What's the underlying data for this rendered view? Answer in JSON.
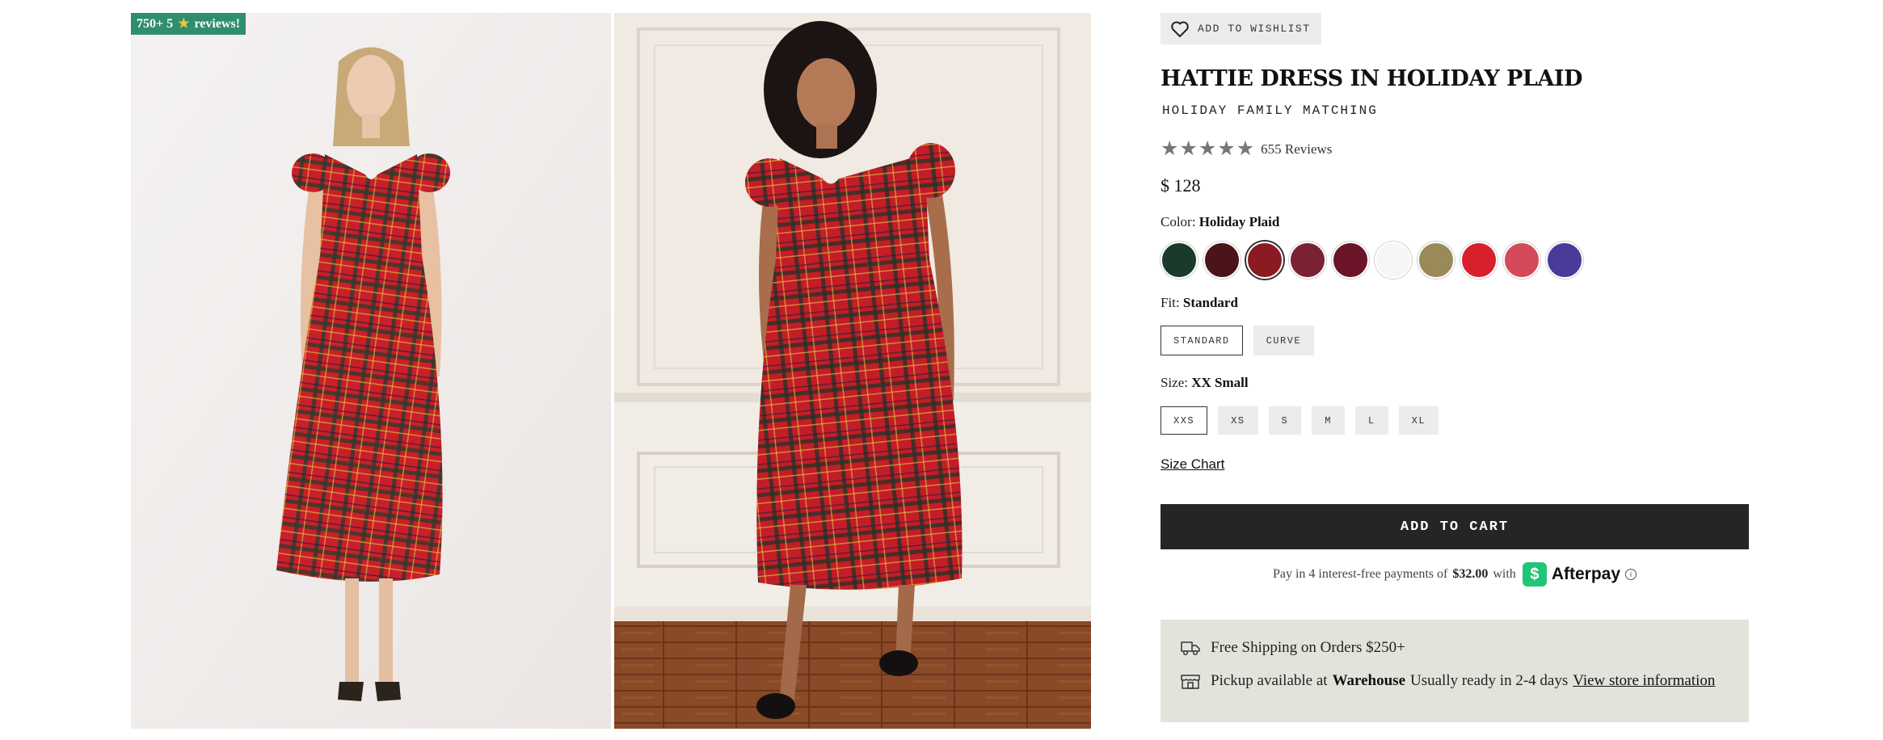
{
  "badge": {
    "count_text": "750+ 5",
    "star": "★",
    "suffix": "reviews!"
  },
  "gallery": {
    "photos": [
      {
        "alt": "Model wearing red plaid dress against white backdrop"
      },
      {
        "alt": "Model wearing red plaid dress in paneled room"
      }
    ]
  },
  "product": {
    "wishlist_label": "ADD TO WISHLIST",
    "title": "HATTIE DRESS IN HOLIDAY PLAID",
    "subtitle": "HOLIDAY FAMILY MATCHING",
    "rating": {
      "stars": 5,
      "reviews_label": "655 Reviews"
    },
    "price": "$ 128",
    "color": {
      "label": "Color:",
      "value": "Holiday Plaid",
      "swatches": [
        {
          "name": "green",
          "color": "#1a3a2a"
        },
        {
          "name": "burgundy",
          "color": "#4a1418"
        },
        {
          "name": "holiday-plaid",
          "color": "#8b1a22",
          "selected": true
        },
        {
          "name": "wine-stripe",
          "color": "#7a2232"
        },
        {
          "name": "berry-floral",
          "color": "#6b1428"
        },
        {
          "name": "white",
          "color": "#f6f6f6"
        },
        {
          "name": "gold-floral",
          "color": "#9a8a5a"
        },
        {
          "name": "red",
          "color": "#d8202c"
        },
        {
          "name": "pink-floral",
          "color": "#d44a5a"
        },
        {
          "name": "purple",
          "color": "#4a3a9a"
        }
      ]
    },
    "fit": {
      "label": "Fit:",
      "value": "Standard",
      "options": [
        {
          "label": "STANDARD",
          "selected": true
        },
        {
          "label": "CURVE",
          "selected": false
        }
      ]
    },
    "size": {
      "label": "Size:",
      "value": "XX Small",
      "options": [
        {
          "label": "XXS",
          "selected": true
        },
        {
          "label": "XS"
        },
        {
          "label": "S"
        },
        {
          "label": "M"
        },
        {
          "label": "L"
        },
        {
          "label": "XL"
        }
      ]
    },
    "size_chart_label": "Size Chart",
    "add_to_cart_label": "ADD TO CART",
    "afterpay": {
      "prefix": "Pay in 4 interest-free payments of",
      "amount": "$32.00",
      "with": "with",
      "logo_glyph": "$",
      "brand": "Afterpay",
      "info_glyph": "i"
    },
    "shipping": {
      "free_shipping": "Free Shipping on Orders $250+",
      "pickup_prefix": "Pickup available at",
      "pickup_location": "Warehouse",
      "pickup_ready": "Usually ready in 2-4 days",
      "store_info_link": "View store information"
    }
  }
}
